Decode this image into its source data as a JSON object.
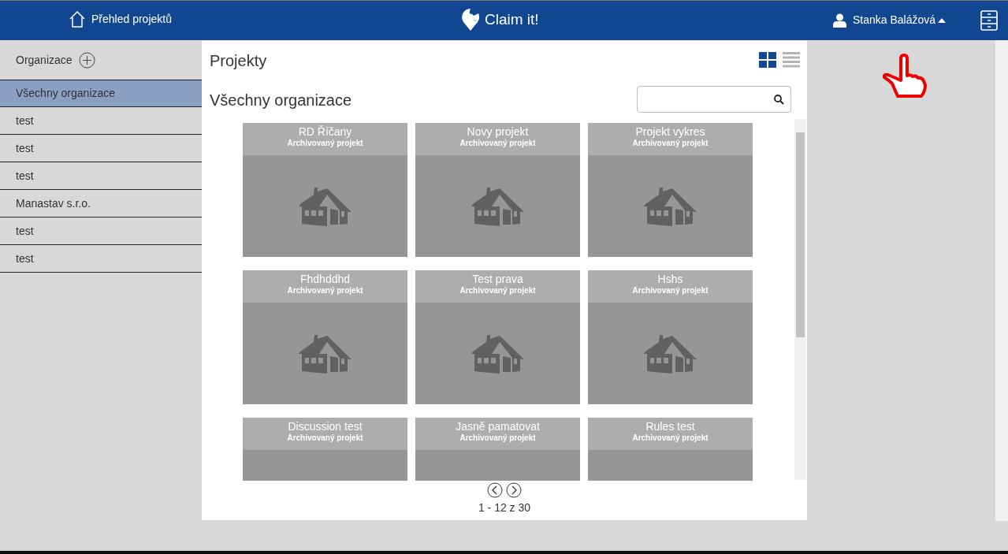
{
  "navbar": {
    "home_link": "Přehled projektů",
    "brand": "Claim it!",
    "user": "Stanka Balážová"
  },
  "sidebar": {
    "title": "Organizace",
    "items": [
      {
        "label": "Všechny organizace",
        "selected": true
      },
      {
        "label": "test",
        "selected": false
      },
      {
        "label": "test",
        "selected": false
      },
      {
        "label": "test",
        "selected": false
      },
      {
        "label": "Manastav s.r.o.",
        "selected": false
      },
      {
        "label": "test",
        "selected": false
      },
      {
        "label": "test",
        "selected": false
      }
    ]
  },
  "main": {
    "title": "Projekty",
    "subtitle": "Všechny organizace",
    "view_toggles": [
      {
        "kind": "grid",
        "selected": true
      },
      {
        "kind": "list",
        "selected": false
      }
    ],
    "projects": [
      {
        "name": "RD Říčany",
        "status": "Archivovaný projekt"
      },
      {
        "name": "Novy projekt",
        "status": "Archivovaný projekt"
      },
      {
        "name": "Projekt vykres",
        "status": "Archivovaný projekt"
      },
      {
        "name": "Fhdhddhd",
        "status": "Archivovaný projekt"
      },
      {
        "name": "Test prava",
        "status": "Archivovaný projekt"
      },
      {
        "name": "Hshs",
        "status": "Archivovaný projekt"
      },
      {
        "name": "Discussion test",
        "status": "Archivovaný projekt"
      },
      {
        "name": "Jasně pamatovat",
        "status": "Archivovaný projekt"
      },
      {
        "name": "Rules test",
        "status": "Archivovaný projekt"
      }
    ],
    "pagination": "1 - 12 z 30"
  }
}
